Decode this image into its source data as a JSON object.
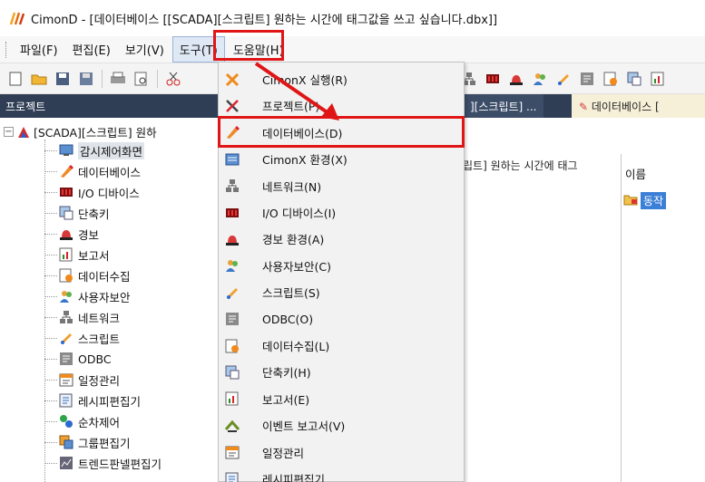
{
  "window": {
    "title": "CimonD - [데이터베이스 [[SCADA][스크립트] 원하는 시간에 태그값을 쓰고 싶습니다.dbx]]"
  },
  "menubar": {
    "items": [
      {
        "label": "파일(F)"
      },
      {
        "label": "편집(E)"
      },
      {
        "label": "보기(V)"
      },
      {
        "label": "도구(T)"
      },
      {
        "label": "도움말(H)"
      }
    ]
  },
  "toolbar": {
    "icons": [
      "new-file-icon",
      "open-folder-icon",
      "save-icon",
      "save-all-icon",
      "print-icon",
      "print-preview-icon",
      "cut-icon"
    ],
    "right_icons": [
      "network-icon",
      "io-device-icon",
      "alarm-icon",
      "user-security-icon",
      "script-icon",
      "odbc-icon",
      "data-collect-icon",
      "shortcut-icon",
      "report-icon"
    ]
  },
  "panel": {
    "title": "프로젝트"
  },
  "tabs": [
    {
      "label": "][스크립트] ..."
    },
    {
      "label": "데이터베이스 ["
    }
  ],
  "tree": {
    "root": "[SCADA][스크립트] 원하",
    "items": [
      {
        "label": "감시제어화면",
        "icon": "monitor-screen-icon"
      },
      {
        "label": "데이터베이스",
        "icon": "database-icon"
      },
      {
        "label": "I/O 디바이스",
        "icon": "io-device-icon"
      },
      {
        "label": "단축키",
        "icon": "shortcut-icon"
      },
      {
        "label": "경보",
        "icon": "alarm-icon"
      },
      {
        "label": "보고서",
        "icon": "report-icon"
      },
      {
        "label": "데이터수집",
        "icon": "data-collect-icon"
      },
      {
        "label": "사용자보안",
        "icon": "user-security-icon"
      },
      {
        "label": "네트워크",
        "icon": "network-icon"
      },
      {
        "label": "스크립트",
        "icon": "script-icon"
      },
      {
        "label": "ODBC",
        "icon": "odbc-icon"
      },
      {
        "label": "일정관리",
        "icon": "schedule-icon"
      },
      {
        "label": "레시피편집기",
        "icon": "recipe-icon"
      },
      {
        "label": "순차제어",
        "icon": "sequence-icon"
      },
      {
        "label": "그룹편집기",
        "icon": "group-editor-icon"
      },
      {
        "label": "트렌드판넬편집기",
        "icon": "trend-panel-icon"
      }
    ]
  },
  "content": {
    "doc_header": "립트] 원하는 시간에 태그",
    "property_panel": {
      "header": "이름",
      "row_value": "동작"
    }
  },
  "tools_menu": {
    "items": [
      {
        "label": "CimonX 실행(R)",
        "icon": "cimonx-run-icon"
      },
      {
        "label": "프로젝트(P)",
        "icon": "project-tools-icon"
      },
      {
        "label": "데이터베이스(D)",
        "icon": "database-icon"
      },
      {
        "label": "CimonX 환경(X)",
        "icon": "cimonx-env-icon"
      },
      {
        "label": "네트워크(N)",
        "icon": "network-icon"
      },
      {
        "label": "I/O 디바이스(I)",
        "icon": "io-device-icon"
      },
      {
        "label": "경보 환경(A)",
        "icon": "alarm-icon"
      },
      {
        "label": "사용자보안(C)",
        "icon": "user-security-icon"
      },
      {
        "label": "스크립트(S)",
        "icon": "script-icon"
      },
      {
        "label": "ODBC(O)",
        "icon": "odbc-icon"
      },
      {
        "label": "데이터수집(L)",
        "icon": "data-collect-icon"
      },
      {
        "label": "단축키(H)",
        "icon": "shortcut-icon"
      },
      {
        "label": "보고서(E)",
        "icon": "report-icon"
      },
      {
        "label": "이벤트 보고서(V)",
        "icon": "event-report-icon"
      },
      {
        "label": "일정관리",
        "icon": "schedule-icon"
      },
      {
        "label": "레시피편집기",
        "icon": "recipe-icon"
      }
    ]
  },
  "colors": {
    "highlight": "#e01616",
    "panel_header": "#2f3e55",
    "selection": "#3b7fd6"
  }
}
